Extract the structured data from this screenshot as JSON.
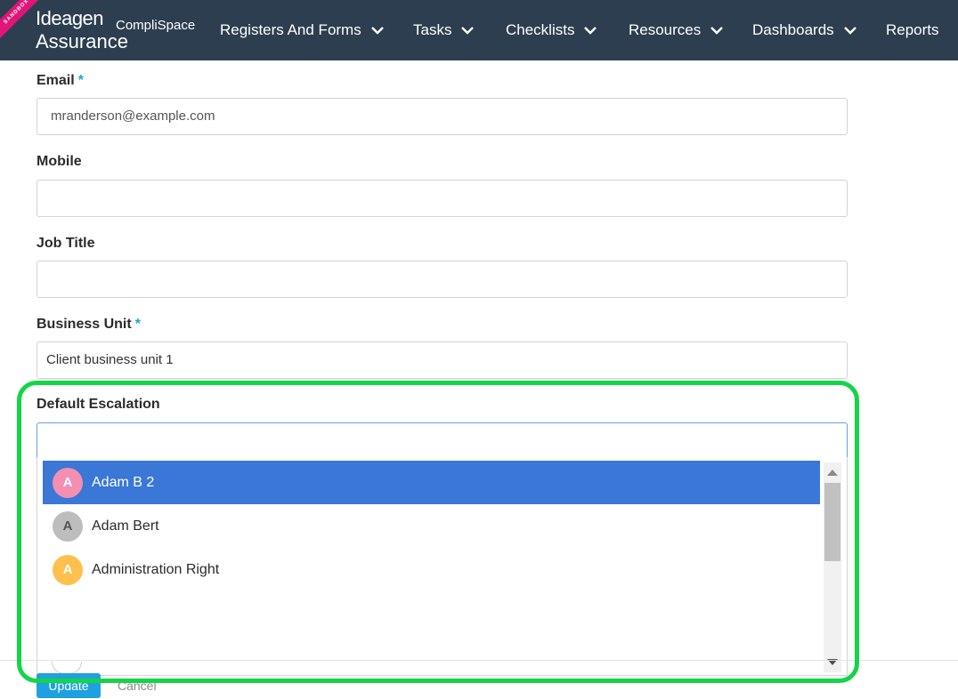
{
  "app": {
    "sandbox_label": "SANDBOX",
    "brand": "Ideagen",
    "brand_sub": "CompliSpace",
    "product": "Assurance"
  },
  "nav": {
    "items": [
      {
        "label": "Registers And Forms"
      },
      {
        "label": "Tasks"
      },
      {
        "label": "Checklists"
      },
      {
        "label": "Resources"
      },
      {
        "label": "Dashboards"
      },
      {
        "label": "Reports"
      }
    ]
  },
  "form": {
    "email": {
      "label": "Email",
      "required": "*",
      "placeholder": "mranderson@example.com"
    },
    "mobile": {
      "label": "Mobile"
    },
    "job_title": {
      "label": "Job Title"
    },
    "business_unit": {
      "label": "Business Unit",
      "required": "*",
      "value": "Client business unit 1"
    },
    "default_escalation": {
      "label": "Default Escalation",
      "options": [
        {
          "initial": "A",
          "name": "Adam B 2",
          "color": "#f48fb1",
          "selected": true
        },
        {
          "initial": "A",
          "name": "Adam Bert",
          "color": "#bdbdbd",
          "selected": false
        },
        {
          "initial": "A",
          "name": "Administration Right",
          "color": "#ffc04d",
          "selected": false
        }
      ]
    }
  },
  "actions": {
    "update_label": "Update",
    "cancel_label": "Cancel"
  },
  "colors": {
    "topbar": "#2c3e50",
    "accent": "#3a77d6",
    "highlight": "#14d448",
    "required": "#1fa0d8"
  }
}
